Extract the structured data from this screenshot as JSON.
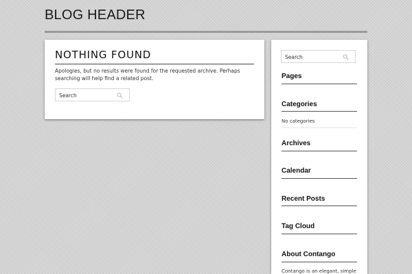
{
  "header": {
    "site_title": "BLOG HEADER"
  },
  "main": {
    "title": "NOTHING FOUND",
    "message": "Apologies, but no results were found for the requested archive. Perhaps searching will help find a related post.",
    "search": {
      "placeholder": "Search"
    }
  },
  "sidebar": {
    "search": {
      "placeholder": "Search"
    },
    "widgets": [
      {
        "title": "Pages"
      },
      {
        "title": "Categories",
        "text": "No categories"
      },
      {
        "title": "Archives"
      },
      {
        "title": "Calendar"
      },
      {
        "title": "Recent Posts"
      },
      {
        "title": "Tag Cloud"
      },
      {
        "title": "About Contango",
        "text": "Contango is an elegant, simple"
      }
    ]
  },
  "icons": {
    "search": "search-icon"
  },
  "colors": {
    "background": "#d3d3d3",
    "panel": "#ffffff",
    "header_rule": "#9a9a9a"
  }
}
